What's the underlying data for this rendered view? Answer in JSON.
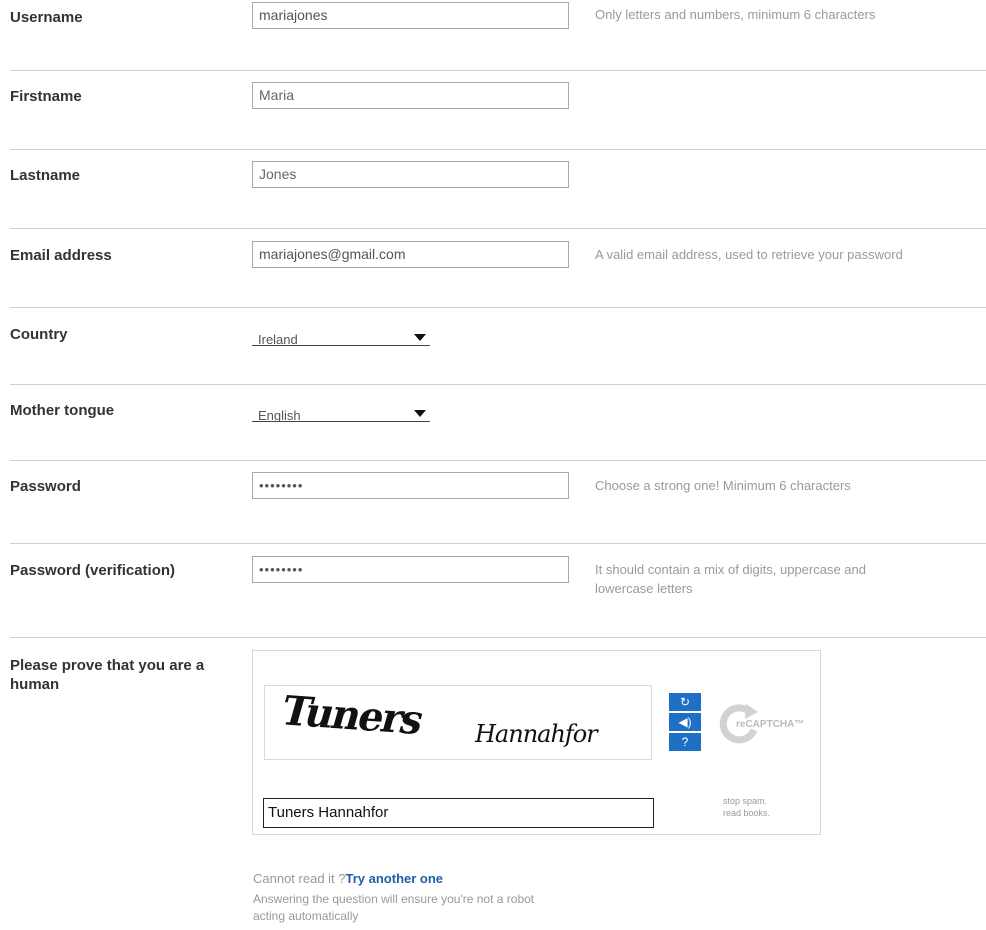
{
  "rows": {
    "username": {
      "label": "Username",
      "value": "mariajones",
      "hint": "Only letters and numbers, minimum 6 characters"
    },
    "firstname": {
      "label": "Firstname",
      "value": "Maria"
    },
    "lastname": {
      "label": "Lastname",
      "value": "Jones"
    },
    "email": {
      "label": "Email address",
      "value": "mariajones@gmail.com",
      "hint": "A valid email address, used to retrieve your password"
    },
    "country": {
      "label": "Country",
      "value": "Ireland"
    },
    "mother_tongue": {
      "label": "Mother tongue",
      "value": "English"
    },
    "password": {
      "label": "Password",
      "value": "••••••••",
      "hint": "Choose a strong one! Minimum 6 characters"
    },
    "password_verification": {
      "label": "Password (verification)",
      "value": "••••••••",
      "hint_line1": "It should contain a mix of digits, uppercase and",
      "hint_line2": "lowercase letters"
    }
  },
  "captcha": {
    "label_line1": "Please prove that you are a",
    "label_line2": "human",
    "word1": "Tuners",
    "word2": "Hannahfor",
    "input_value": "Tuners Hannahfor",
    "brand": "reCAPTCHA™",
    "tagline1": "stop spam.",
    "tagline2": "read books.",
    "refresh_icon": "refresh-icon",
    "audio_icon": "audio-icon",
    "help_icon": "help-icon"
  },
  "footer": {
    "cannot_read": "Cannot read it ?",
    "try_another": "Try another one",
    "note_line1": "Answering the question will ensure you're not a robot",
    "note_line2": "acting automatically"
  },
  "colors": {
    "link": "#1f5ea8",
    "captcha_button": "#1f6fc6"
  }
}
